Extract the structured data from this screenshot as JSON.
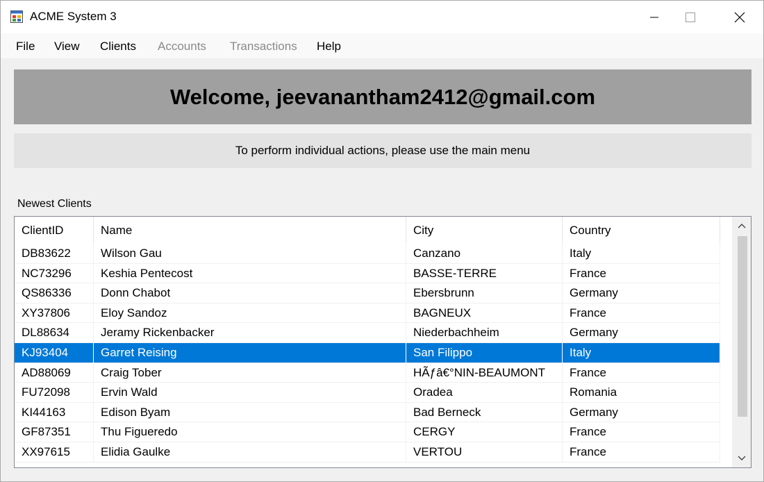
{
  "window": {
    "title": "ACME System 3"
  },
  "menu": {
    "items": [
      {
        "label": "File",
        "enabled": true
      },
      {
        "label": "View",
        "enabled": true
      },
      {
        "label": "Clients",
        "enabled": true
      },
      {
        "label": "Accounts",
        "enabled": false
      },
      {
        "label": "Transactions",
        "enabled": false
      },
      {
        "label": "Help",
        "enabled": true
      }
    ]
  },
  "welcome": {
    "text": "Welcome, jeevanantham2412@gmail.com"
  },
  "info": {
    "text": "To perform individual actions, please use the main menu"
  },
  "clients": {
    "label": "Newest Clients",
    "columns": [
      "ClientID",
      "Name",
      "City",
      "Country"
    ],
    "selected_index": 5,
    "rows": [
      [
        "DB83622",
        "Wilson Gau",
        "Canzano",
        "Italy"
      ],
      [
        "NC73296",
        "Keshia Pentecost",
        "BASSE-TERRE",
        "France"
      ],
      [
        "QS86336",
        "Donn Chabot",
        "Ebersbrunn",
        "Germany"
      ],
      [
        "XY37806",
        "Eloy Sandoz",
        "BAGNEUX",
        "France"
      ],
      [
        "DL88634",
        "Jeramy Rickenbacker",
        "Niederbachheim",
        "Germany"
      ],
      [
        "KJ93404",
        "Garret Reising",
        "San Filippo",
        "Italy"
      ],
      [
        "AD88069",
        "Craig Tober",
        "HÃƒâ€°NIN-BEAUMONT",
        "France"
      ],
      [
        "FU72098",
        "Ervin Wald",
        "Oradea",
        "Romania"
      ],
      [
        "KI44163",
        "Edison Byam",
        "Bad Berneck",
        "Germany"
      ],
      [
        "GF87351",
        "Thu Figueredo",
        "CERGY",
        "France"
      ],
      [
        "XX97615",
        "Elidia Gaulke",
        "VERTOU",
        "France"
      ]
    ]
  },
  "colors": {
    "selection": "#0078d7",
    "welcome_bg": "#a0a0a0",
    "info_bg": "#e3e3e3",
    "disabled_menu": "#8a8a8a"
  },
  "icons": {
    "app": "app-window-icon",
    "minimize": "minimize-icon",
    "maximize": "maximize-icon",
    "close": "close-icon"
  }
}
